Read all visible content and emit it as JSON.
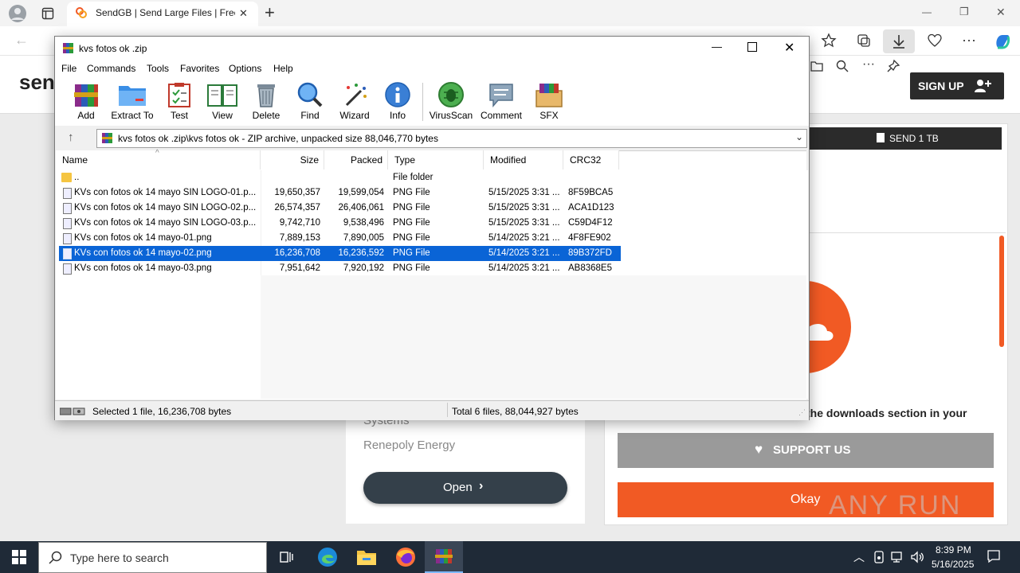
{
  "browser": {
    "tab_title": "SendGB | Send Large Files | Free f",
    "new_tab_symbol": "+",
    "window_minimize": "—",
    "window_restore": "❐",
    "window_close": "✕"
  },
  "website": {
    "logo_text": "sen",
    "signup_label": "SIGN UP",
    "send_button_label": "SEND 1 TB",
    "systems_text": "Systems",
    "renepoly_text": "Renepoly Energy",
    "open_button_label": "Open",
    "downloads_text": "the downloads section in your",
    "support_label": "SUPPORT US",
    "okay_label": "Okay",
    "watermark": "ANY RUN"
  },
  "winrar": {
    "title": "kvs fotos ok .zip",
    "menu": [
      "File",
      "Commands",
      "Tools",
      "Favorites",
      "Options",
      "Help"
    ],
    "toolbar": [
      "Add",
      "Extract To",
      "Test",
      "View",
      "Delete",
      "Find",
      "Wizard",
      "Info",
      "VirusScan",
      "Comment",
      "SFX"
    ],
    "path": "kvs fotos ok .zip\\kvs fotos ok  - ZIP archive, unpacked size 88,046,770 bytes",
    "columns": [
      "Name",
      "Size",
      "Packed",
      "Type",
      "Modified",
      "CRC32"
    ],
    "rows": [
      {
        "name": "..",
        "size": "",
        "packed": "",
        "type": "File folder",
        "modified": "",
        "crc": ""
      },
      {
        "name": "KVs con fotos ok 14 mayo SIN LOGO-01.p...",
        "size": "19,650,357",
        "packed": "19,599,054",
        "type": "PNG File",
        "modified": "5/15/2025 3:31 ...",
        "crc": "8F59BCA5"
      },
      {
        "name": "KVs con fotos ok 14 mayo SIN LOGO-02.p...",
        "size": "26,574,357",
        "packed": "26,406,061",
        "type": "PNG File",
        "modified": "5/15/2025 3:31 ...",
        "crc": "ACA1D123"
      },
      {
        "name": "KVs con fotos ok 14 mayo SIN LOGO-03.p...",
        "size": "9,742,710",
        "packed": "9,538,496",
        "type": "PNG File",
        "modified": "5/15/2025 3:31 ...",
        "crc": "C59D4F12"
      },
      {
        "name": "KVs con fotos ok 14 mayo-01.png",
        "size": "7,889,153",
        "packed": "7,890,005",
        "type": "PNG File",
        "modified": "5/14/2025 3:21 ...",
        "crc": "4F8FE902"
      },
      {
        "name": "KVs con fotos ok 14 mayo-02.png",
        "size": "16,236,708",
        "packed": "16,236,592",
        "type": "PNG File",
        "modified": "5/14/2025 3:21 ...",
        "crc": "89B372FD"
      },
      {
        "name": "KVs con fotos ok 14 mayo-03.png",
        "size": "7,951,642",
        "packed": "7,920,192",
        "type": "PNG File",
        "modified": "5/14/2025 3:21 ...",
        "crc": "AB8368E5"
      }
    ],
    "status_left": "Selected 1 file, 16,236,708 bytes",
    "status_right": "Total 6 files, 88,044,927 bytes"
  },
  "taskbar": {
    "search_placeholder": "Type here to search",
    "time": "8:39 PM",
    "date": "5/16/2025"
  },
  "colors": {
    "selection": "#0a64d6",
    "okay_orange": "#f15a24",
    "send_dark": "#2b2b2b",
    "open_dark": "#34404a",
    "support_gray": "#9a9a9a",
    "taskbar": "#1f2a37"
  }
}
